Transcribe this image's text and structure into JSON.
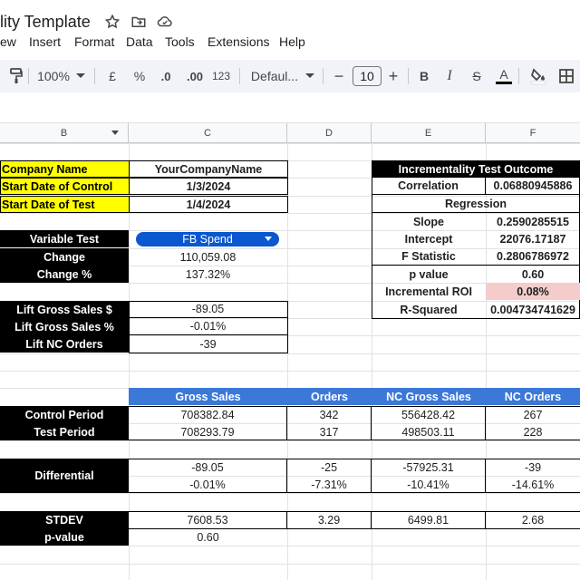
{
  "doc": {
    "title": "lity Template"
  },
  "menu": [
    "ew",
    "Insert",
    "Format",
    "Data",
    "Tools",
    "Extensions",
    "Help"
  ],
  "toolbar": {
    "zoom": "100%",
    "currency": "£",
    "percent": "%",
    "dec_decrease": ".0",
    "dec_increase": ".00",
    "number_format": "123",
    "font": "Defaul...",
    "font_size": "10",
    "minus": "−",
    "plus": "+",
    "bold": "B",
    "italic": "I",
    "strike": "S",
    "text_color": "A"
  },
  "columns": [
    "B",
    "C",
    "D",
    "E",
    "F"
  ],
  "info": {
    "company_label": "Company Name",
    "company_value": "YourCompanyName",
    "control_label": "Start Date of Control",
    "control_value": "1/3/2024",
    "test_label": "Start Date of Test",
    "test_value": "1/4/2024"
  },
  "variable": {
    "label": "Variable Test",
    "value": "FB Spend",
    "change_label": "Change",
    "change_value": "110,059.08",
    "change_pct_label": "Change %",
    "change_pct_value": "137.32%"
  },
  "lift": {
    "gross_label": "Lift Gross Sales $",
    "gross_value": "-89.05",
    "gross_pct_label": "Lift Gross Sales %",
    "gross_pct_value": "-0.01%",
    "nc_label": "Lift NC Orders",
    "nc_value": "-39"
  },
  "outcome": {
    "title": "Incrementality Test Outcome",
    "correlation_label": "Correlation",
    "correlation_value": "0.06880945886",
    "regression_label": "Regression",
    "slope_label": "Slope",
    "slope_value": "0.2590285515",
    "intercept_label": "Intercept",
    "intercept_value": "22076.17187",
    "f_label": "F Statistic",
    "f_value": "0.2806786972",
    "p_label": "p value",
    "p_value": "0.60",
    "roi_label": "Incremental ROI",
    "roi_value": "0.08%",
    "r2_label": "R-Squared",
    "r2_value": "0.004734741629"
  },
  "table": {
    "headers": [
      "Gross Sales",
      "Orders",
      "NC Gross Sales",
      "NC Orders"
    ],
    "control_label": "Control Period",
    "control": [
      "708382.84",
      "342",
      "556428.42",
      "267"
    ],
    "test_label": "Test Period",
    "test": [
      "708293.79",
      "317",
      "498503.11",
      "228"
    ],
    "diff_label": "Differential",
    "diff": [
      "-89.05",
      "-25",
      "-57925.31",
      "-39"
    ],
    "diff_pct": [
      "-0.01%",
      "-7.31%",
      "-10.41%",
      "-14.61%"
    ],
    "stdev_label": "STDEV",
    "stdev": [
      "7608.53",
      "3.29",
      "6499.81",
      "2.68"
    ],
    "pvalue_label": "p-value",
    "pvalue": "0.60"
  },
  "colors": {
    "yellow": "#ffff00",
    "blue": "#3c78d8",
    "chip": "#0b57d0",
    "pink": "#f4cccc",
    "toolbar": "#f0f4f9"
  }
}
